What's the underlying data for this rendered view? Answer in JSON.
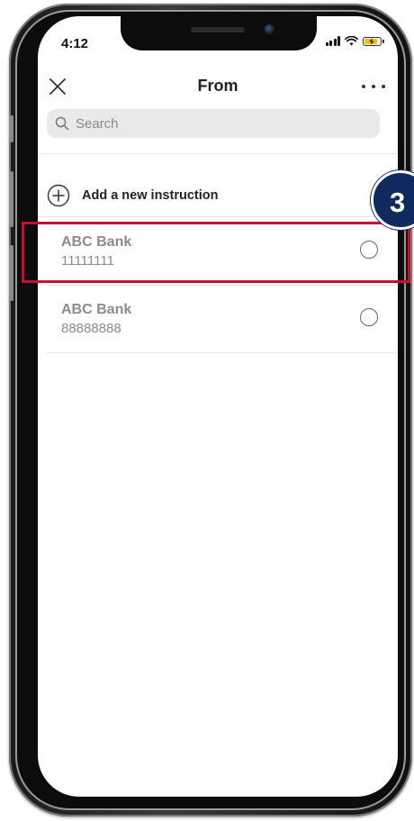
{
  "status_bar": {
    "time": "4:12"
  },
  "header": {
    "title": "From"
  },
  "search": {
    "placeholder": "Search"
  },
  "add_instruction": {
    "label": "Add a new instruction"
  },
  "accounts": [
    {
      "name": "ABC Bank",
      "number": "11111111",
      "selected": false
    },
    {
      "name": "ABC Bank",
      "number": "88888888",
      "selected": false
    }
  ],
  "callout": {
    "step_number": "3",
    "highlight_color": "#c8102e",
    "badge_color": "#0f2a5e"
  },
  "icons": {
    "close": "close-icon",
    "more": "more-dots-icon",
    "search": "search-icon",
    "add": "plus-circle-icon"
  },
  "colors": {
    "search_bg": "#e9e9e9",
    "battery_fill": "#f2c500",
    "account_text": "#8c8c8c"
  }
}
